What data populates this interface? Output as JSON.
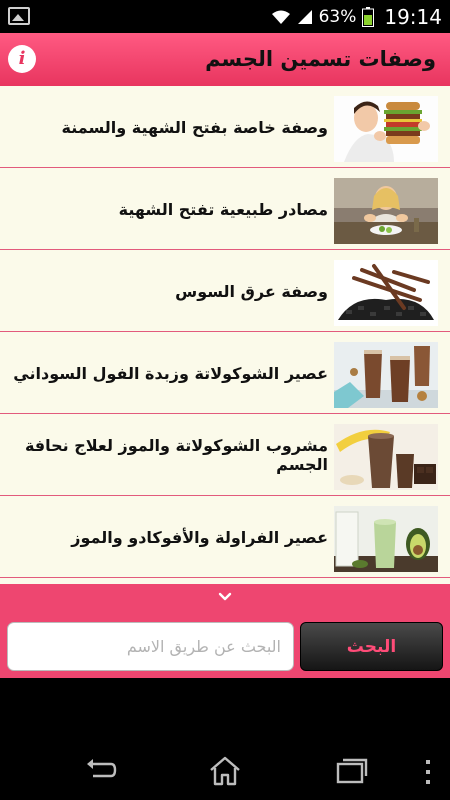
{
  "status_bar": {
    "battery_percent": "63%",
    "time": "19:14",
    "icons": [
      "gallery-icon",
      "wifi-icon",
      "signal-icon",
      "battery-icon"
    ]
  },
  "app_bar": {
    "title": "وصفات تسمين الجسم",
    "info_icon": "i"
  },
  "list": {
    "items": [
      {
        "label": "وصفة خاصة بفتح الشهية والسمنة",
        "thumb": "woman-eating-burger"
      },
      {
        "label": "مصادر طبيعية تفتح الشهية",
        "thumb": "girl-at-table"
      },
      {
        "label": "وصفة عرق السوس",
        "thumb": "licorice-root"
      },
      {
        "label": "عصير الشوكولاتة وزبدة الفول السوداني",
        "thumb": "chocolate-smoothie"
      },
      {
        "label": "مشروب الشوكولاتة والموز لعلاج نحافة الجسم",
        "thumb": "chocolate-banana-shake"
      },
      {
        "label": "عصير الفراولة والأفوكادو والموز",
        "thumb": "avocado-smoothie"
      }
    ]
  },
  "more": {
    "icon": "chevron-down-icon"
  },
  "search": {
    "button_label": "البحث",
    "placeholder": "البحث عن طريق الاسم",
    "value": ""
  },
  "colors": {
    "accent": "#ee4670",
    "list_background": "#fbfaea",
    "search_button_text": "#ff4c78"
  }
}
